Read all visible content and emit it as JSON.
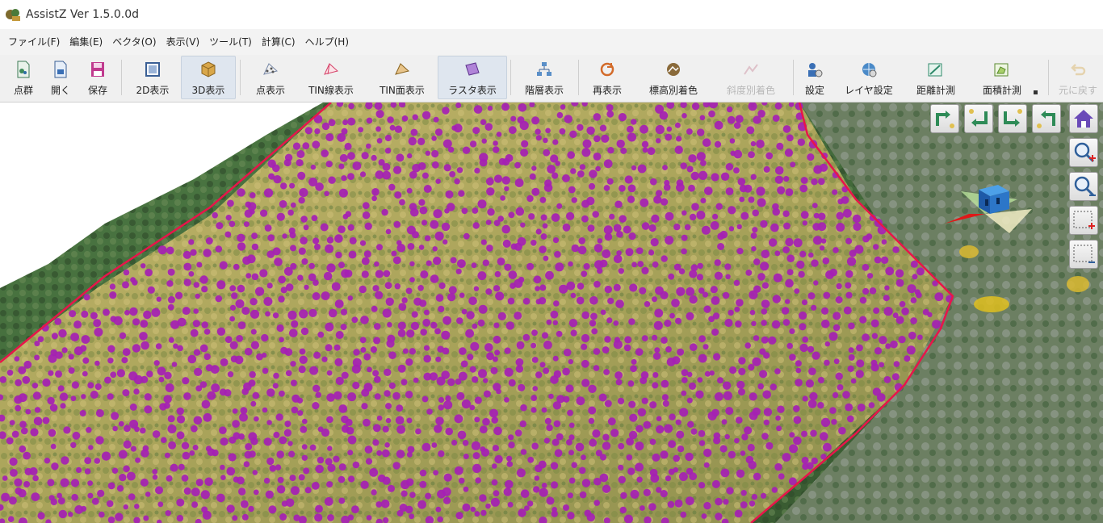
{
  "window": {
    "title": "AssistZ  Ver 1.5.0.0d"
  },
  "menu": [
    "ファイル(F)",
    "編集(E)",
    "ベクタ(O)",
    "表示(V)",
    "ツール(T)",
    "計算(C)",
    "ヘルプ(H)"
  ],
  "toolbar": [
    {
      "label": "点群",
      "icon": "point-cloud-file-icon",
      "state": "normal"
    },
    {
      "label": "開く",
      "icon": "open-file-icon",
      "state": "normal"
    },
    {
      "label": "保存",
      "icon": "save-icon",
      "state": "normal"
    },
    {
      "label": "2D表示",
      "icon": "2d-view-icon",
      "state": "normal"
    },
    {
      "label": "3D表示",
      "icon": "3d-view-icon",
      "state": "active"
    },
    {
      "label": "点表示",
      "icon": "point-display-icon",
      "state": "normal"
    },
    {
      "label": "TIN線表示",
      "icon": "tin-line-icon",
      "state": "normal"
    },
    {
      "label": "TIN面表示",
      "icon": "tin-surface-icon",
      "state": "normal"
    },
    {
      "label": "ラスタ表示",
      "icon": "raster-display-icon",
      "state": "active"
    },
    {
      "label": "階層表示",
      "icon": "hierarchy-icon",
      "state": "normal"
    },
    {
      "label": "再表示",
      "icon": "redisplay-icon",
      "state": "normal"
    },
    {
      "label": "標高別着色",
      "icon": "elevation-color-icon",
      "state": "normal"
    },
    {
      "label": "斜度別着色",
      "icon": "slope-color-icon",
      "state": "disabled"
    },
    {
      "label": "設定",
      "icon": "settings-icon",
      "state": "normal"
    },
    {
      "label": "レイヤ設定",
      "icon": "layer-settings-icon",
      "state": "normal"
    },
    {
      "label": "距離計測",
      "icon": "distance-measure-icon",
      "state": "normal"
    },
    {
      "label": "面積計測",
      "icon": "area-measure-icon",
      "state": "normal"
    },
    {
      "label": "元に戻す",
      "icon": "undo-icon",
      "state": "disabled"
    }
  ],
  "nav_controls": {
    "rotate_buttons": [
      "rotate-left-up-icon",
      "rotate-left-down-icon",
      "rotate-right-down-icon",
      "rotate-right-up-icon"
    ],
    "side_buttons": [
      "home-icon",
      "zoom-in-icon",
      "zoom-out-icon",
      "zoom-in-dotted-icon",
      "zoom-out-dotted-icon"
    ]
  },
  "colors": {
    "tree_markers": "#a51fb4",
    "boundary_line": "#e8154a",
    "forest_dark": "#3f6a3a",
    "forest_light": "#b5ab55"
  }
}
